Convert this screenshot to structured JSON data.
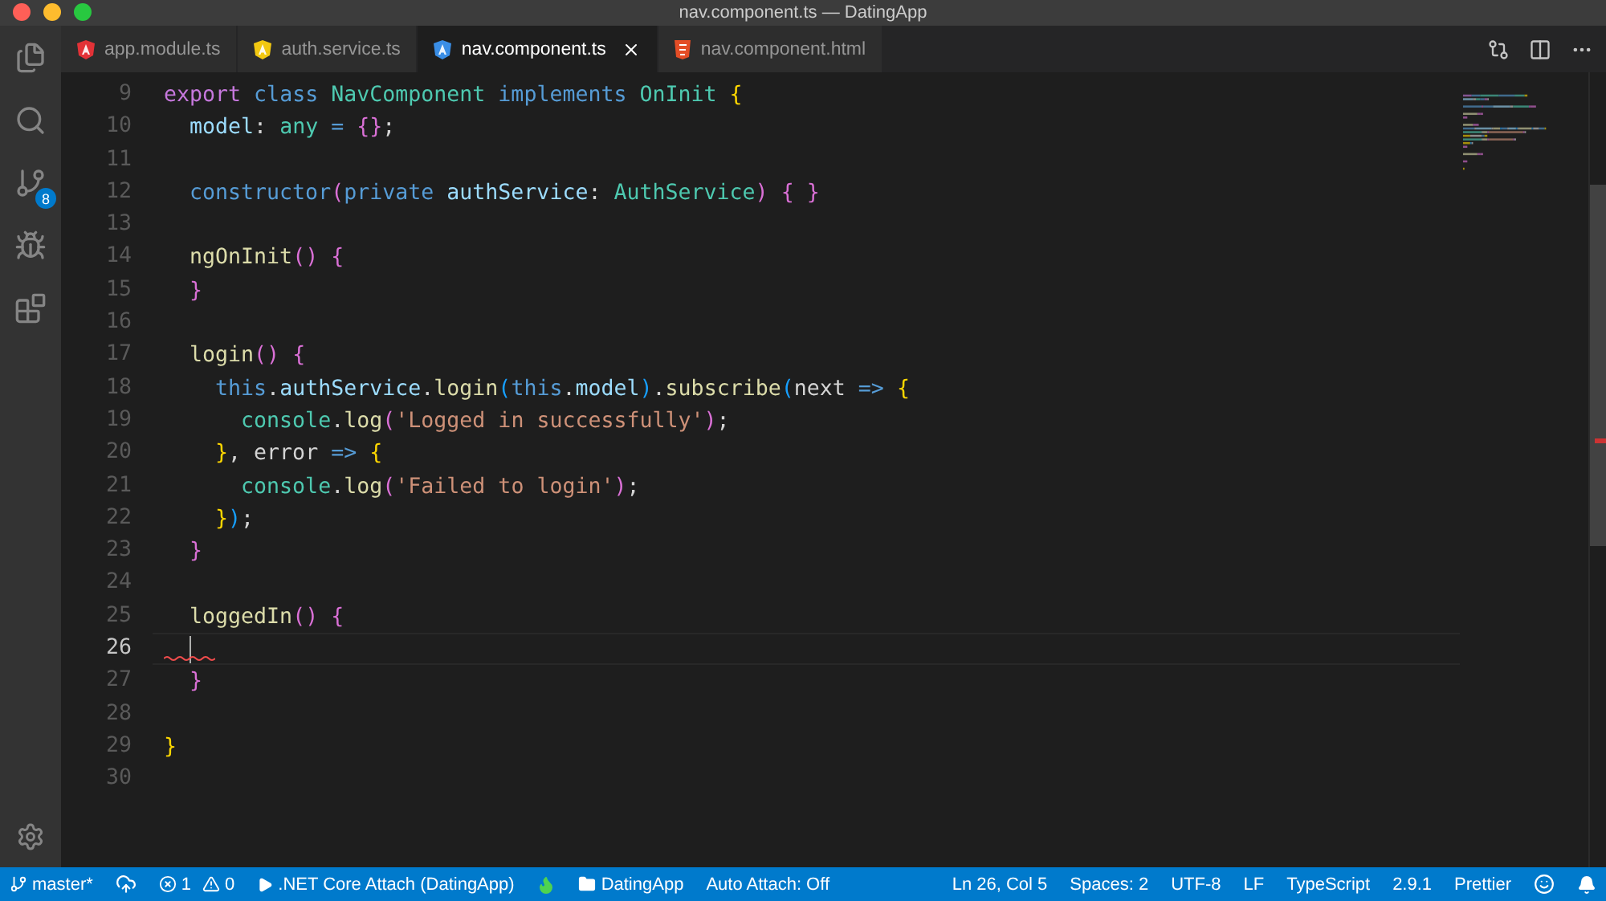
{
  "window": {
    "title": "nav.component.ts — DatingApp"
  },
  "activity_bar": {
    "source_control_badge": "8"
  },
  "tabs": [
    {
      "label": "app.module.ts",
      "selected": false,
      "kind": "angular",
      "color": "#e23237"
    },
    {
      "label": "auth.service.ts",
      "selected": false,
      "kind": "angular",
      "color": "#f2c811"
    },
    {
      "label": "nav.component.ts",
      "selected": true,
      "kind": "angular",
      "color": "#3a8ee6"
    },
    {
      "label": "nav.component.html",
      "selected": false,
      "kind": "html",
      "color": "#e44d26"
    }
  ],
  "editor": {
    "lines": [
      {
        "number": "9",
        "current": false,
        "error": false,
        "tokens": [
          {
            "text": "export",
            "kind": "keyword"
          },
          {
            "text": " class",
            "kind": "storage"
          },
          {
            "text": " NavComponent",
            "kind": "type"
          },
          {
            "text": " implements",
            "kind": "storage"
          },
          {
            "text": " OnInit",
            "kind": "type"
          },
          {
            "text": " {",
            "kind": "brace1"
          }
        ]
      },
      {
        "number": "10",
        "current": false,
        "error": false,
        "tokens": [
          {
            "text": "  model",
            "kind": "variable"
          },
          {
            "text": ": ",
            "kind": "plain"
          },
          {
            "text": "any",
            "kind": "type"
          },
          {
            "text": " = ",
            "kind": "operator"
          },
          {
            "text": "{}",
            "kind": "brace2"
          },
          {
            "text": ";",
            "kind": "plain"
          }
        ]
      },
      {
        "number": "11",
        "current": false,
        "error": false
      },
      {
        "number": "12",
        "current": false,
        "error": false,
        "tokens": [
          {
            "text": "  constructor",
            "kind": "storage"
          },
          {
            "text": "(",
            "kind": "brace2"
          },
          {
            "text": "private",
            "kind": "storage"
          },
          {
            "text": " authService",
            "kind": "variable"
          },
          {
            "text": ": ",
            "kind": "plain"
          },
          {
            "text": "AuthService",
            "kind": "type"
          },
          {
            "text": ")",
            "kind": "brace2"
          },
          {
            "text": " { }",
            "kind": "brace2"
          }
        ]
      },
      {
        "number": "13",
        "current": false,
        "error": false
      },
      {
        "number": "14",
        "current": false,
        "error": false,
        "tokens": [
          {
            "text": "  ngOnInit",
            "kind": "function"
          },
          {
            "text": "()",
            "kind": "brace2"
          },
          {
            "text": " {",
            "kind": "brace2"
          }
        ]
      },
      {
        "number": "15",
        "current": false,
        "error": false,
        "tokens": [
          {
            "text": "  }",
            "kind": "brace2"
          }
        ]
      },
      {
        "number": "16",
        "current": false,
        "error": false
      },
      {
        "number": "17",
        "current": false,
        "error": false,
        "tokens": [
          {
            "text": "  login",
            "kind": "function"
          },
          {
            "text": "()",
            "kind": "brace2"
          },
          {
            "text": " {",
            "kind": "brace2"
          }
        ]
      },
      {
        "number": "18",
        "current": false,
        "error": false,
        "tokens": [
          {
            "text": "    this",
            "kind": "storage"
          },
          {
            "text": ".",
            "kind": "plain"
          },
          {
            "text": "authService",
            "kind": "variable"
          },
          {
            "text": ".",
            "kind": "plain"
          },
          {
            "text": "login",
            "kind": "function"
          },
          {
            "text": "(",
            "kind": "brace3"
          },
          {
            "text": "this",
            "kind": "storage"
          },
          {
            "text": ".",
            "kind": "plain"
          },
          {
            "text": "model",
            "kind": "variable"
          },
          {
            "text": ")",
            "kind": "brace3"
          },
          {
            "text": ".",
            "kind": "plain"
          },
          {
            "text": "subscribe",
            "kind": "function"
          },
          {
            "text": "(",
            "kind": "brace3"
          },
          {
            "text": "next",
            "kind": "plain"
          },
          {
            "text": " => ",
            "kind": "operator"
          },
          {
            "text": "{",
            "kind": "brace1"
          }
        ]
      },
      {
        "number": "19",
        "current": false,
        "error": false,
        "tokens": [
          {
            "text": "      console",
            "kind": "type"
          },
          {
            "text": ".",
            "kind": "plain"
          },
          {
            "text": "log",
            "kind": "function"
          },
          {
            "text": "(",
            "kind": "brace2"
          },
          {
            "text": "'Logged in successfully'",
            "kind": "string"
          },
          {
            "text": ")",
            "kind": "brace2"
          },
          {
            "text": ";",
            "kind": "plain"
          }
        ]
      },
      {
        "number": "20",
        "current": false,
        "error": false,
        "tokens": [
          {
            "text": "    }",
            "kind": "brace1"
          },
          {
            "text": ", error ",
            "kind": "plain"
          },
          {
            "text": "=>",
            "kind": "operator"
          },
          {
            "text": " {",
            "kind": "brace1"
          }
        ]
      },
      {
        "number": "21",
        "current": false,
        "error": false,
        "tokens": [
          {
            "text": "      console",
            "kind": "type"
          },
          {
            "text": ".",
            "kind": "plain"
          },
          {
            "text": "log",
            "kind": "function"
          },
          {
            "text": "(",
            "kind": "brace2"
          },
          {
            "text": "'Failed to login'",
            "kind": "string"
          },
          {
            "text": ")",
            "kind": "brace2"
          },
          {
            "text": ";",
            "kind": "plain"
          }
        ]
      },
      {
        "number": "22",
        "current": false,
        "error": false,
        "tokens": [
          {
            "text": "    }",
            "kind": "brace1"
          },
          {
            "text": ")",
            "kind": "brace3"
          },
          {
            "text": ";",
            "kind": "plain"
          }
        ]
      },
      {
        "number": "23",
        "current": false,
        "error": false,
        "tokens": [
          {
            "text": "  }",
            "kind": "brace2"
          }
        ]
      },
      {
        "number": "24",
        "current": false,
        "error": false
      },
      {
        "number": "25",
        "current": false,
        "error": false,
        "tokens": [
          {
            "text": "  loggedIn",
            "kind": "function"
          },
          {
            "text": "()",
            "kind": "brace2"
          },
          {
            "text": " {",
            "kind": "brace2"
          }
        ]
      },
      {
        "number": "26",
        "current": true,
        "error": true
      },
      {
        "number": "27",
        "current": false,
        "error": false,
        "tokens": [
          {
            "text": "  }",
            "kind": "brace2"
          }
        ]
      },
      {
        "number": "28",
        "current": false,
        "error": false
      },
      {
        "number": "29",
        "current": false,
        "error": false,
        "tokens": [
          {
            "text": "}",
            "kind": "brace1"
          }
        ]
      },
      {
        "number": "30",
        "current": false,
        "error": false
      }
    ]
  },
  "status_bar": {
    "left": [
      {
        "kind": "branch",
        "label": "master*"
      },
      {
        "kind": "sync"
      },
      {
        "kind": "problems",
        "errors": "1",
        "warnings": "0"
      },
      {
        "kind": "play",
        "label": ".NET Core Attach (DatingApp)"
      },
      {
        "kind": "flame"
      },
      {
        "kind": "folder",
        "label": "DatingApp"
      },
      {
        "kind": "text",
        "label": "Auto Attach: Off"
      }
    ],
    "right": [
      {
        "kind": "text",
        "label": "Ln 26, Col 5"
      },
      {
        "kind": "text",
        "label": "Spaces: 2"
      },
      {
        "kind": "text",
        "label": "UTF-8"
      },
      {
        "kind": "text",
        "label": "LF"
      },
      {
        "kind": "text",
        "label": "TypeScript"
      },
      {
        "kind": "text",
        "label": "2.9.1"
      },
      {
        "kind": "text",
        "label": "Prettier"
      },
      {
        "kind": "smiley"
      },
      {
        "kind": "bell"
      }
    ]
  }
}
